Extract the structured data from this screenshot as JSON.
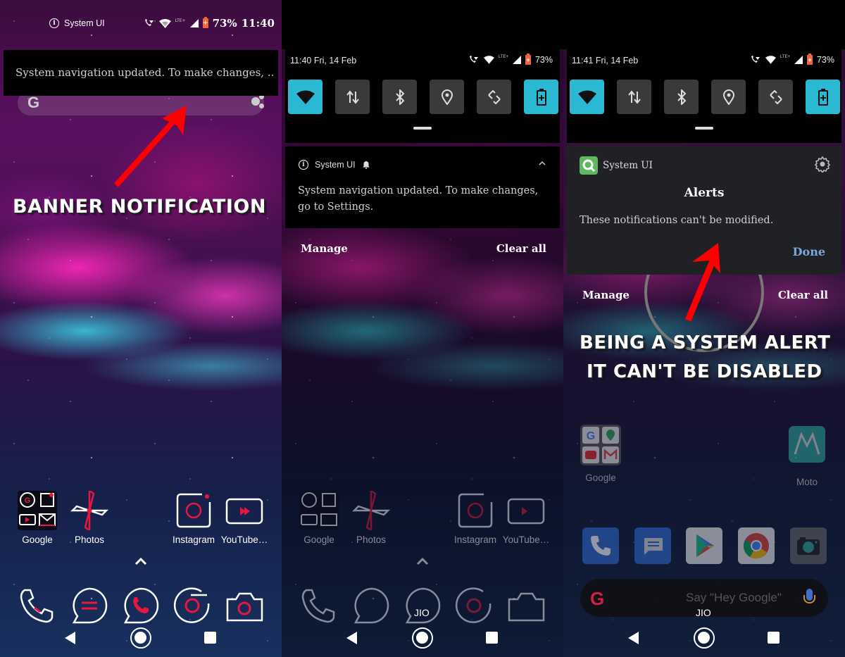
{
  "panel1": {
    "status_bar": {
      "notif_app": "System UI",
      "lte_label": "LTE+",
      "battery_pct": "73%",
      "time": "11:40"
    },
    "banner": {
      "text": "System navigation updated. To make changes, .."
    },
    "search": {
      "logo": "G"
    },
    "caption": "BANNER NOTIFICATION",
    "apps": [
      {
        "label": "Google",
        "icon": "google-folder-icon"
      },
      {
        "label": "Photos",
        "icon": "photos-icon"
      },
      {
        "label": "Instagram",
        "icon": "instagram-icon"
      },
      {
        "label": "YouTube…",
        "icon": "youtube-icon"
      }
    ],
    "dock": [
      "phone-icon",
      "messages-icon",
      "whatsapp-icon",
      "chrome-icon",
      "camera-icon"
    ]
  },
  "panel2": {
    "quick_settings": {
      "datetime": "11:40  Fri, 14 Feb",
      "lte_label": "LTE+",
      "battery_pct": "73%",
      "tiles": [
        {
          "name": "wifi",
          "active": true
        },
        {
          "name": "mobile-data",
          "active": false
        },
        {
          "name": "bluetooth",
          "active": false
        },
        {
          "name": "location",
          "active": false
        },
        {
          "name": "auto-rotate",
          "active": false
        },
        {
          "name": "battery-saver",
          "active": true
        }
      ]
    },
    "notification": {
      "app": "System UI",
      "body": "System navigation updated. To make changes, go to Settings."
    },
    "actions": {
      "manage": "Manage",
      "clear_all": "Clear all"
    },
    "apps": [
      {
        "label": "Google"
      },
      {
        "label": "Photos"
      },
      {
        "label": "Instagram"
      },
      {
        "label": "YouTube…"
      }
    ],
    "carrier": "JIO"
  },
  "panel3": {
    "quick_settings": {
      "datetime": "11:41  Fri, 14 Feb",
      "lte_label": "LTE+",
      "battery_pct": "73%"
    },
    "alerts_dialog": {
      "app": "System UI",
      "title": "Alerts",
      "message": "These notifications can't be modified.",
      "done": "Done"
    },
    "actions": {
      "manage": "Manage",
      "clear_all": "Clear all"
    },
    "caption_line1": "BEING A SYSTEM ALERT",
    "caption_line2": "IT CAN'T BE DISABLED",
    "apps": [
      {
        "label": "Google"
      },
      {
        "label": "Moto"
      }
    ],
    "search_hint": "Say \"Hey Google\"",
    "search_logo": "G",
    "carrier": "JIO"
  },
  "colors": {
    "tile_active": "#2ab8d3",
    "tile_inactive": "#3a3a3a",
    "done_link": "#7ea7e0",
    "annotation_red": "#ff0000",
    "icon_accent": "#e8173e"
  }
}
